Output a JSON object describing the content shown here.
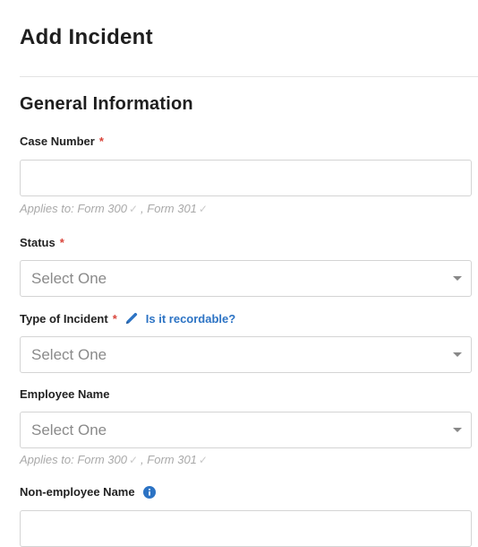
{
  "header": {
    "title": "Add Incident"
  },
  "section": {
    "title": "General Information"
  },
  "fields": {
    "case_number": {
      "label": "Case Number",
      "required_mark": "*",
      "value": "",
      "applies": {
        "prefix": "Applies to:",
        "form_a": "Form 300",
        "separator": ",",
        "form_b": "Form 301"
      }
    },
    "status": {
      "label": "Status",
      "required_mark": "*",
      "selected": "Select One"
    },
    "type_of_incident": {
      "label": "Type of Incident",
      "required_mark": "*",
      "help_link": "Is it recordable?",
      "selected": "Select One"
    },
    "employee_name": {
      "label": "Employee Name",
      "selected": "Select One",
      "applies": {
        "prefix": "Applies to:",
        "form_a": "Form 300",
        "separator": ",",
        "form_b": "Form 301"
      }
    },
    "non_employee_name": {
      "label": "Non-employee Name",
      "value": ""
    }
  },
  "icons": {
    "check": "check-icon",
    "pencil": "pencil-icon",
    "info": "info-icon",
    "caret": "chevron-down-icon"
  },
  "colors": {
    "required": "#d9443a",
    "link": "#2c73c4",
    "border": "#d4d4d4",
    "placeholder": "#8a8a8a",
    "muted": "#a9a9a9"
  }
}
